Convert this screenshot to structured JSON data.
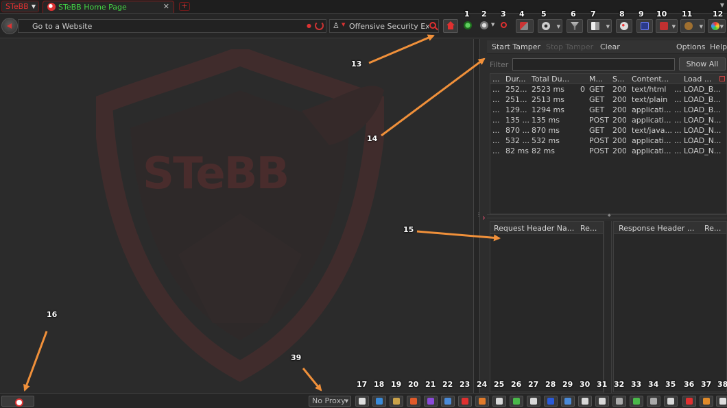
{
  "app_menu": {
    "label": "STeBB"
  },
  "tab": {
    "title": "STeBB Home Page",
    "close": "✕"
  },
  "newtab": {
    "label": "+"
  },
  "nav": {
    "url_placeholder": "Go to a Website",
    "search_value": "Offensive Security Ex",
    "search_engine_icon": "person-icon"
  },
  "watermark": {
    "text": "STeBB"
  },
  "tamper": {
    "start": "Start Tamper",
    "stop": "Stop Tamper",
    "clear": "Clear",
    "options": "Options",
    "help": "Help",
    "filter_label": "Filter",
    "show_all": "Show All",
    "columns": [
      "...",
      "Dur...",
      "Total Du...",
      "",
      "M...",
      "S...",
      "Content...",
      "",
      "Load ..."
    ],
    "rows": [
      [
        "...",
        "252...",
        "2523 ms",
        "0",
        "GET",
        "200",
        "text/html",
        "...",
        "LOAD_B..."
      ],
      [
        "...",
        "251...",
        "2513 ms",
        "",
        "GET",
        "200",
        "text/plain",
        "...",
        "LOAD_B..."
      ],
      [
        "...",
        "129...",
        "1294 ms",
        "",
        "GET",
        "200",
        "applicati...",
        "...",
        "LOAD_B..."
      ],
      [
        "...",
        "135 ...",
        "135 ms",
        "",
        "POST",
        "200",
        "applicati...",
        "...",
        "LOAD_N..."
      ],
      [
        "...",
        "870 ...",
        "870 ms",
        "",
        "GET",
        "200",
        "text/java...",
        "...",
        "LOAD_N..."
      ],
      [
        "...",
        "532 ...",
        "532 ms",
        "",
        "POST",
        "200",
        "applicati...",
        "...",
        "LOAD_N..."
      ],
      [
        "...",
        "82 ms",
        "82 ms",
        "",
        "POST",
        "200",
        "applicati...",
        "...",
        "LOAD_N..."
      ]
    ],
    "request_header_name": "Request Header Na...",
    "request_header_value": "Re...",
    "response_header_name": "Response Header ...",
    "response_header_value": "Re..."
  },
  "status": {
    "proxy": "No Proxy"
  },
  "annotations": {
    "top": [
      "1",
      "2",
      "3",
      "4",
      "5",
      "6",
      "7",
      "8",
      "9",
      "10",
      "11",
      "12"
    ],
    "n13": "13",
    "n14": "14",
    "n15": "15",
    "n16": "16",
    "n39": "39",
    "bottom": [
      "17",
      "18",
      "19",
      "20",
      "21",
      "22",
      "23",
      "24",
      "25",
      "26",
      "27",
      "28",
      "29",
      "30",
      "31",
      "32",
      "33",
      "34",
      "35",
      "36",
      "37",
      "38"
    ]
  },
  "colors": {
    "accent": "#e03030",
    "tab_text": "#44d444",
    "annotation_arrow": "#f0903a"
  }
}
